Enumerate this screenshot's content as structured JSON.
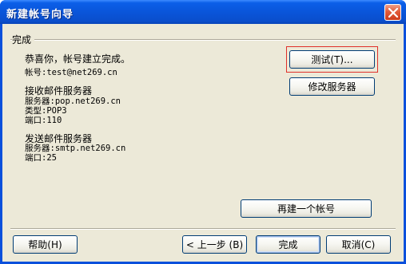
{
  "window": {
    "title": "新建帐号向导"
  },
  "group": {
    "label": "完成"
  },
  "info": {
    "congrats": "恭喜你，帐号建立完成。",
    "account": "帐号:test@net269.cn",
    "incoming_heading": "接收邮件服务器",
    "incoming_server": "服务器:pop.net269.cn",
    "incoming_type": "类型:POP3",
    "incoming_port": "端口:110",
    "outgoing_heading": "发送邮件服务器",
    "outgoing_server": "服务器:smtp.net269.cn",
    "outgoing_port": "端口:25"
  },
  "buttons": {
    "test": "测试(T)...",
    "modify_server": "修改服务器",
    "create_another": "再建一个帐号",
    "help": "帮助(H)",
    "back": "< 上一步 (B)",
    "finish": "完成",
    "cancel": "取消(C)"
  },
  "icons": {
    "close": "close-icon"
  },
  "colors": {
    "titlebar": "#0a54d8",
    "highlight": "#e0302a",
    "dialog_bg": "#ece9d8"
  }
}
